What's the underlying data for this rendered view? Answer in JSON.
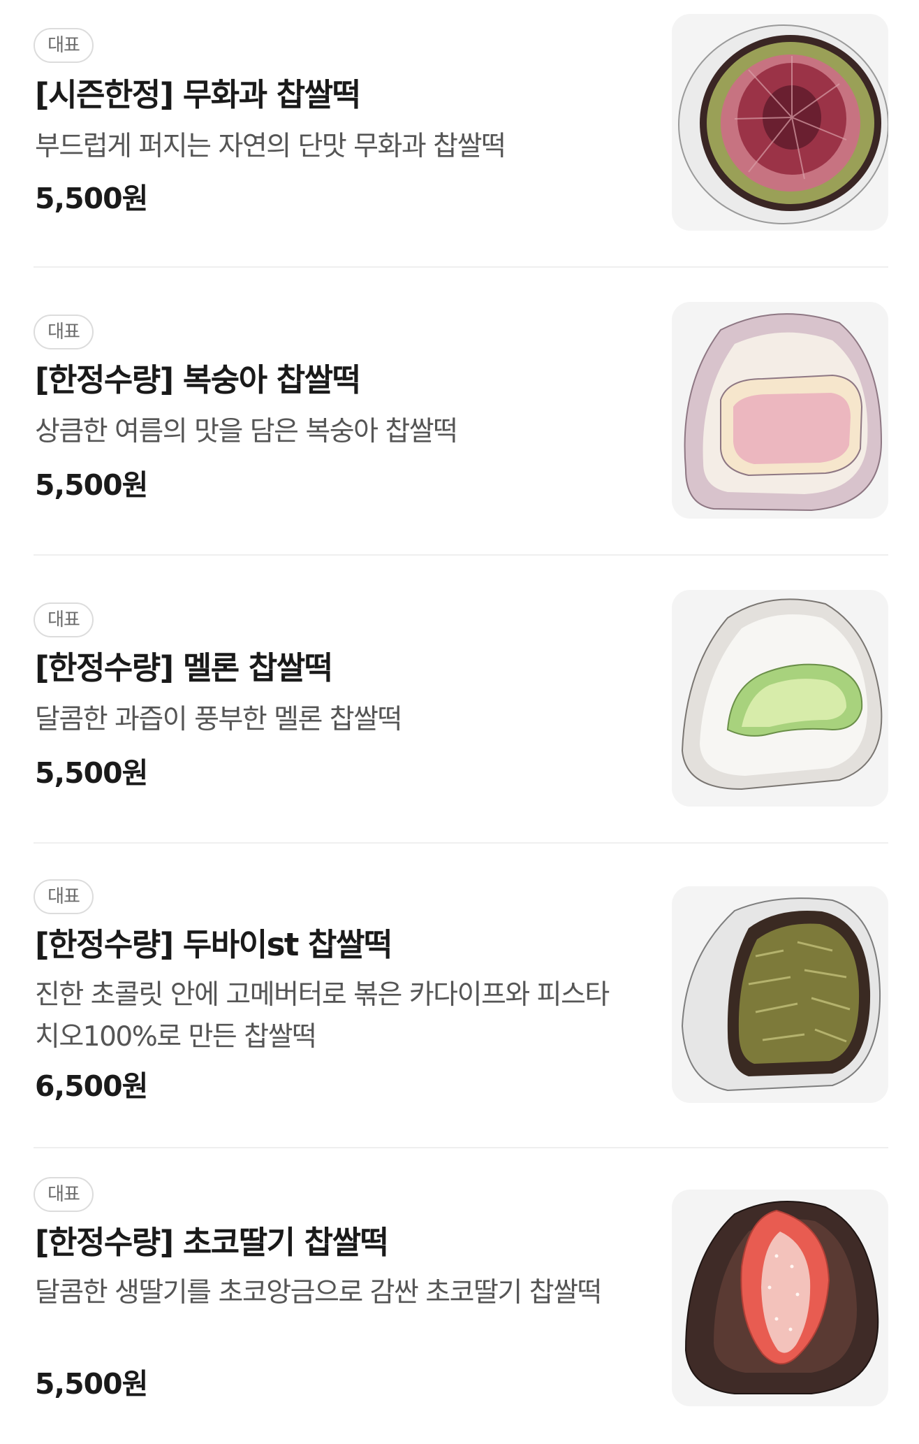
{
  "menu": {
    "items": [
      {
        "badge": "대표",
        "title": "[시즌한정] 무화과 찹쌀떡",
        "description": "부드럽게 퍼지는 자연의 단맛 무화과 찹쌀떡",
        "price": "5,500원",
        "image_icon": "fig-mochi-icon"
      },
      {
        "badge": "대표",
        "title": "[한정수량] 복숭아 찹쌀떡",
        "description": "상큼한 여름의 맛을 담은 복숭아 찹쌀떡",
        "price": "5,500원",
        "image_icon": "peach-mochi-icon"
      },
      {
        "badge": "대표",
        "title": "[한정수량] 멜론 찹쌀떡",
        "description": "달콤한 과즙이 풍부한 멜론 찹쌀떡",
        "price": "5,500원",
        "image_icon": "melon-mochi-icon"
      },
      {
        "badge": "대표",
        "title": "[한정수량] 두바이st 찹쌀떡",
        "description": "진한 초콜릿 안에 고메버터로 볶은 카다이프와 피스타치오100%로 만든 찹쌀떡",
        "price": "6,500원",
        "image_icon": "dubai-pistachio-mochi-icon"
      },
      {
        "badge": "대표",
        "title": "[한정수량] 초코딸기 찹쌀떡",
        "description": "달콤한 생딸기를 초코앙금으로 감싼 초코딸기 찹쌀떡",
        "price": "5,500원",
        "image_icon": "choco-strawberry-mochi-icon"
      }
    ]
  },
  "colors": {
    "title_text": "#1a1a1a",
    "description_text": "#555555",
    "badge_border": "#dcdcdc",
    "divider": "#efefef",
    "thumbnail_background": "#f4f4f4"
  }
}
